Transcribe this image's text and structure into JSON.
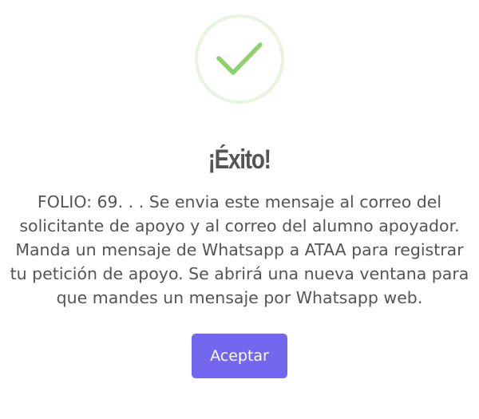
{
  "dialog": {
    "icon": "check-icon",
    "title": "¡Éxito!",
    "message": "FOLIO: 69. . . Se envia este mensaje al correo del solicitante de apoyo y al correo del alumno apoyador. Manda un mensaje de Whatsapp a ATAA para registrar tu petición de apoyo. Se abrirá una nueva ventana para que mandes un mensaje por Whatsapp web.",
    "confirm_label": "Aceptar"
  },
  "colors": {
    "success_ring": "#e7f4df",
    "success_check": "#8fd16e",
    "title_text": "#555555",
    "body_text": "#545454",
    "confirm_button": "#7367f0"
  }
}
